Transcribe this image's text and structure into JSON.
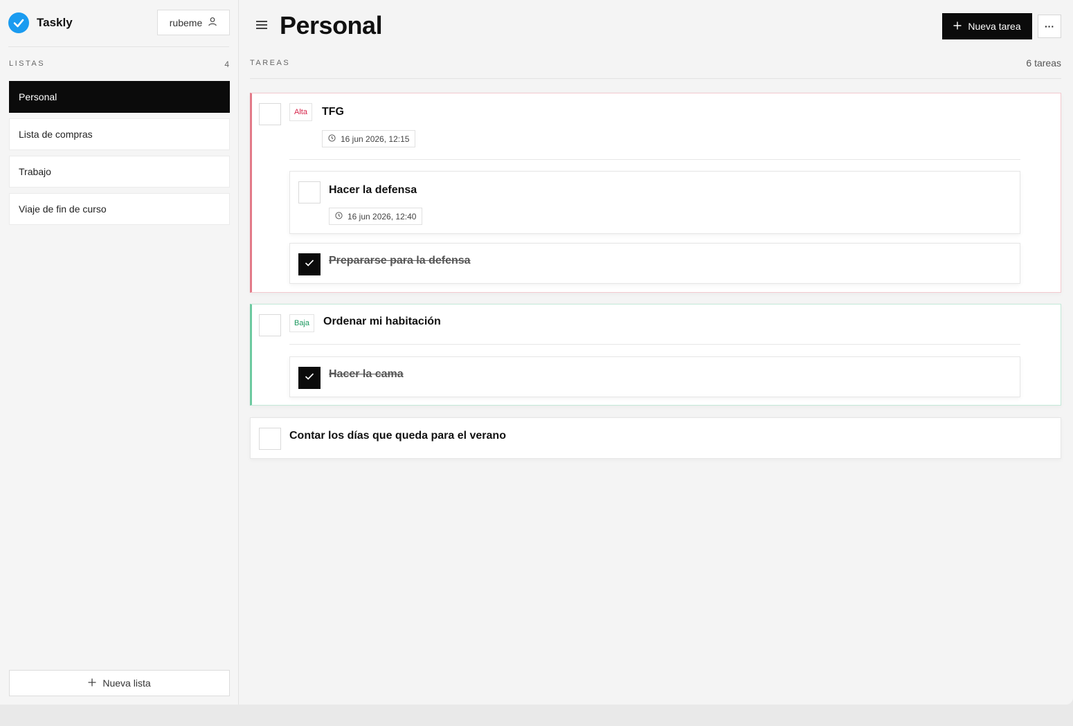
{
  "app": {
    "name": "Taskly"
  },
  "user": {
    "name": "rubeme"
  },
  "sidebar": {
    "section_label": "LISTAS",
    "count": "4",
    "items": [
      {
        "label": "Personal",
        "active": true
      },
      {
        "label": "Lista de compras",
        "active": false
      },
      {
        "label": "Trabajo",
        "active": false
      },
      {
        "label": "Viaje de fin de curso",
        "active": false
      }
    ],
    "new_list_label": "Nueva lista"
  },
  "header": {
    "title": "Personal",
    "new_task_label": "Nueva tarea",
    "more_label": "···"
  },
  "tasks_section": {
    "label": "TAREAS",
    "count_text": "6 tareas"
  },
  "tasks": [
    {
      "title": "TFG",
      "priority": "Alta",
      "due": "16 jun 2026, 12:15",
      "done": false,
      "subtasks": [
        {
          "title": "Hacer la defensa",
          "due": "16 jun 2026, 12:40",
          "done": false
        },
        {
          "title": "Prepararse para la defensa",
          "done": true
        }
      ]
    },
    {
      "title": "Ordenar mi habitación",
      "priority": "Baja",
      "done": false,
      "subtasks": [
        {
          "title": "Hacer la cama",
          "done": true
        }
      ]
    },
    {
      "title": "Contar los días que queda para el verano",
      "done": false,
      "subtasks": []
    }
  ],
  "colors": {
    "brand": "#1a9bf0",
    "priority_high": "#e37a88",
    "priority_low": "#6cc9a0",
    "primary": "#0b0b0b"
  }
}
